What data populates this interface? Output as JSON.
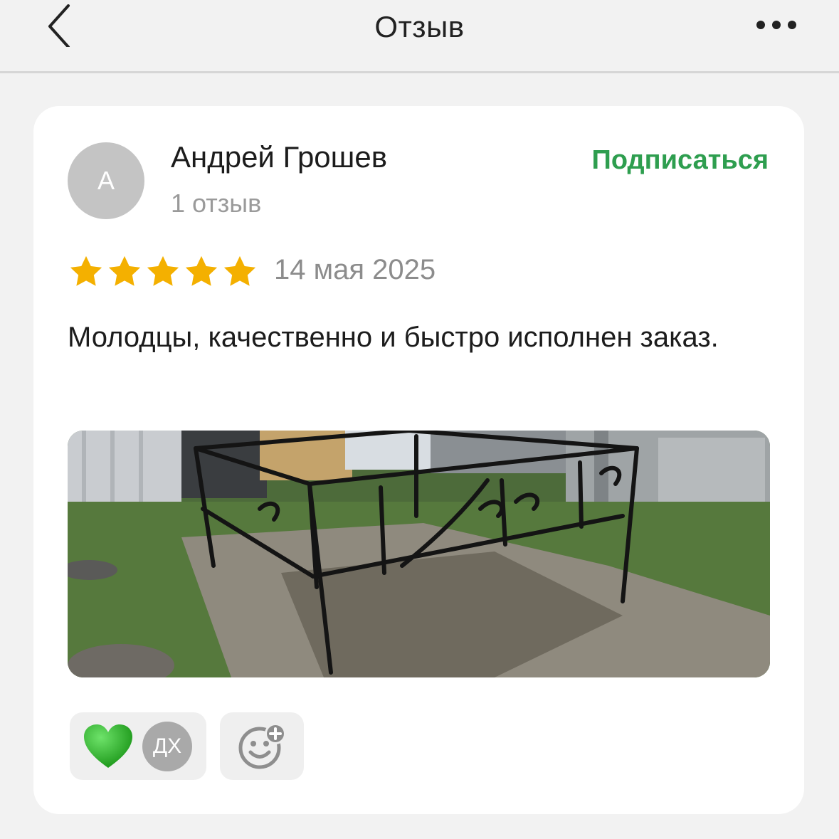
{
  "header": {
    "title": "Отзыв",
    "back_icon": "chevron-left-icon",
    "more_icon": "more-horizontal-icon"
  },
  "review": {
    "author": {
      "initial": "А",
      "name": "Андрей Грошев",
      "reviews_count": "1 отзыв"
    },
    "subscribe_label": "Подписаться",
    "rating": 5,
    "rating_max": 5,
    "date": "14 мая 2025",
    "text": "Молодцы, качественно и быстро исполнен заказ.",
    "photo": {
      "description_icon": "photo-thumbnail"
    },
    "reactions": {
      "heart_icon": "green-heart-icon",
      "reactor_initials": "ДХ",
      "add_reaction_icon": "add-emoji-icon"
    }
  },
  "colors": {
    "accent_green": "#2e9e4f",
    "star": "#f4b000",
    "heart": "#2fb52a"
  }
}
